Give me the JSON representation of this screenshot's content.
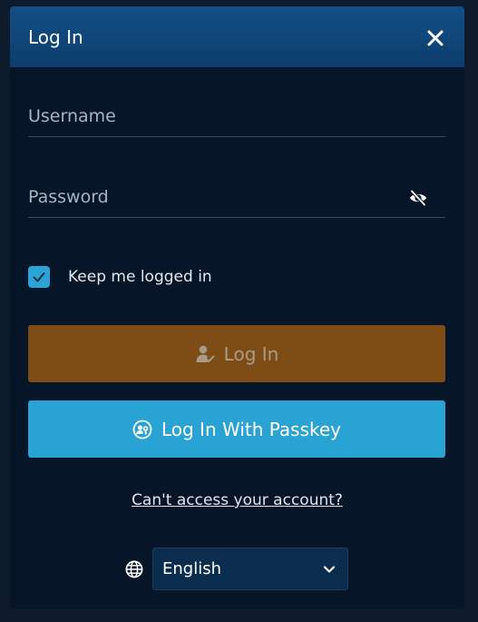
{
  "dialog": {
    "title": "Log In",
    "close_icon": "close-icon"
  },
  "form": {
    "username_placeholder": "Username",
    "username_value": "",
    "password_placeholder": "Password",
    "password_value": "",
    "password_toggle_icon": "eye-off-icon",
    "remember_label": "Keep me logged in",
    "remember_checked": true,
    "login_label": "Log In",
    "login_icon": "user-check-icon",
    "passkey_label": "Log In With Passkey",
    "passkey_icon": "passkey-icon",
    "help_link": "Can't access your account?"
  },
  "language": {
    "icon": "globe-icon",
    "selected": "English"
  },
  "colors": {
    "header": "#134e86",
    "background": "#061628",
    "login_button": "#7e4d16",
    "passkey_button": "#29a3d3",
    "checkbox": "#2aa3d7"
  }
}
